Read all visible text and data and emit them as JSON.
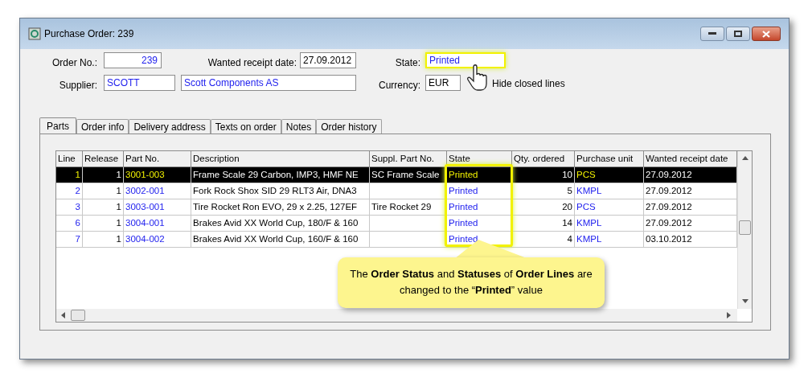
{
  "window": {
    "title": "Purchase Order: 239"
  },
  "form": {
    "order_no_label": "Order No.:",
    "order_no": "239",
    "wanted_date_label": "Wanted receipt date:",
    "wanted_date": "27.09.2012",
    "state_label": "State:",
    "state": "Printed",
    "supplier_label": "Supplier:",
    "supplier_code": "SCOTT",
    "supplier_name": "Scott Components AS",
    "currency_label": "Currency:",
    "currency": "EUR",
    "hide_closed_label": "Hide closed lines"
  },
  "tabs": [
    {
      "label": "Parts",
      "selected": true
    },
    {
      "label": "Order info",
      "selected": false
    },
    {
      "label": "Delivery address",
      "selected": false
    },
    {
      "label": "Texts on order",
      "selected": false
    },
    {
      "label": "Notes",
      "selected": false
    },
    {
      "label": "Order history",
      "selected": false
    }
  ],
  "table": {
    "columns": [
      {
        "label": "Line",
        "kind": "link"
      },
      {
        "label": "Release",
        "kind": "text"
      },
      {
        "label": "Part No.",
        "kind": "link"
      },
      {
        "label": "Description",
        "kind": "text"
      },
      {
        "label": "Suppl. Part No.",
        "kind": "text"
      },
      {
        "label": "State",
        "kind": "link"
      },
      {
        "label": "Qty. ordered",
        "kind": "text"
      },
      {
        "label": "Purchase unit",
        "kind": "link"
      },
      {
        "label": "Wanted receipt date",
        "kind": "text"
      }
    ],
    "rows": [
      {
        "selected": true,
        "cells": [
          "1",
          "1",
          "3001-003",
          "Frame Scale 29 Carbon, IMP3, HMF NE",
          "SC Frame Scale",
          "Printed",
          "10",
          "PCS",
          "27.09.2012"
        ]
      },
      {
        "selected": false,
        "cells": [
          "2",
          "1",
          "3002-001",
          "Fork Rock Shox SID 29 RLT3 Air, DNA3",
          "",
          "Printed",
          "5",
          "KMPL",
          "27.09.2012"
        ]
      },
      {
        "selected": false,
        "cells": [
          "3",
          "1",
          "3003-001",
          "Tire Rocket Ron EVO, 29 x 2.25, 127EF",
          "Tire Rocket 29",
          "Printed",
          "20",
          "PCS",
          "27.09.2012"
        ]
      },
      {
        "selected": false,
        "cells": [
          "6",
          "1",
          "3004-001",
          "Brakes Avid XX World Cup, 180/F & 160",
          "",
          "Printed",
          "14",
          "KMPL",
          "27.09.2012"
        ]
      },
      {
        "selected": false,
        "cells": [
          "7",
          "1",
          "3004-002",
          "Brakes Avid XX World Cup, 160/F & 160",
          "",
          "Printed",
          "4",
          "KMPL",
          "03.10.2012"
        ]
      }
    ]
  },
  "callout": {
    "text": "The **Order Status** and **Statuses** of **Order Lines** are changed to the “**Printed**” value"
  }
}
